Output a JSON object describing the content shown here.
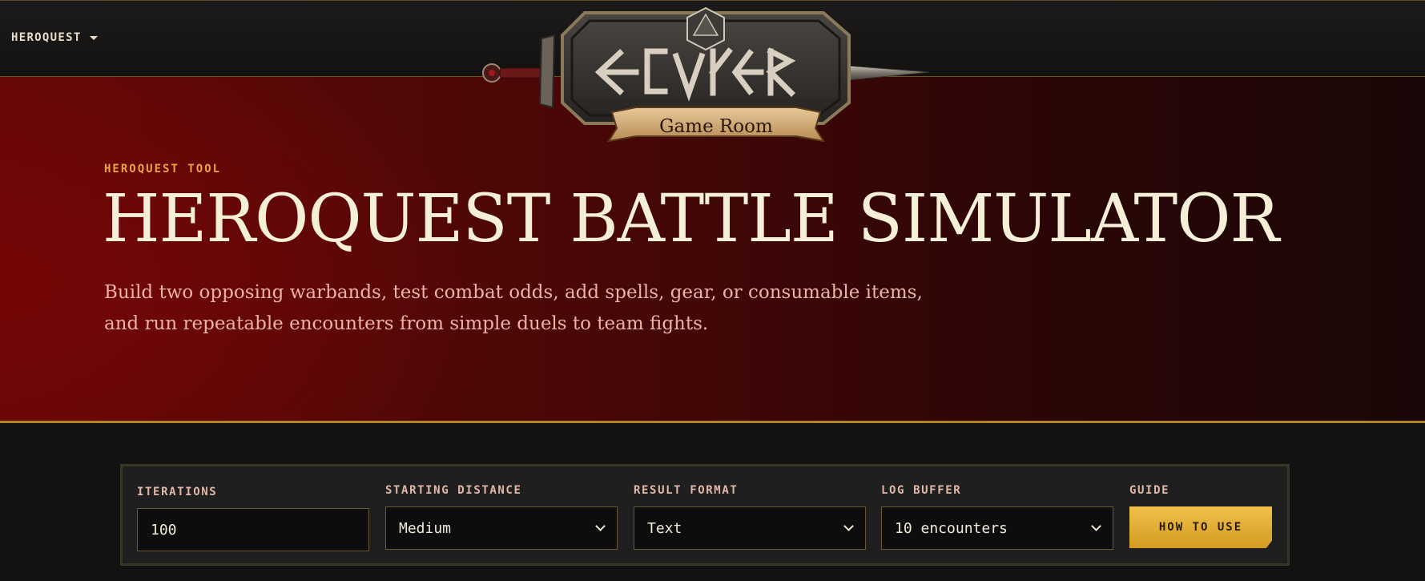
{
  "nav": {
    "menu_label": "HEROQUEST"
  },
  "logo": {
    "banner_text": "Game Room"
  },
  "hero": {
    "eyebrow": "HEROQUEST TOOL",
    "title": "HEROQUEST BATTLE SIMULATOR",
    "subtitle_line1": "Build two opposing warbands, test combat odds, add spells, gear, or consumable items,",
    "subtitle_line2": "and run repeatable encounters from simple duels to team fights."
  },
  "settings": {
    "iterations": {
      "label": "ITERATIONS",
      "value": "100"
    },
    "starting_distance": {
      "label": "STARTING DISTANCE",
      "value": "Medium"
    },
    "result_format": {
      "label": "RESULT FORMAT",
      "value": "Text"
    },
    "log_buffer": {
      "label": "LOG BUFFER",
      "value": "10 encounters"
    },
    "guide": {
      "label": "GUIDE",
      "button_label": "HOW TO USE"
    }
  },
  "colors": {
    "accent_gold": "#d49b22",
    "hero_red": "#620808",
    "eyebrow_orange": "#e9a546",
    "title_cream": "#f5efd8"
  }
}
